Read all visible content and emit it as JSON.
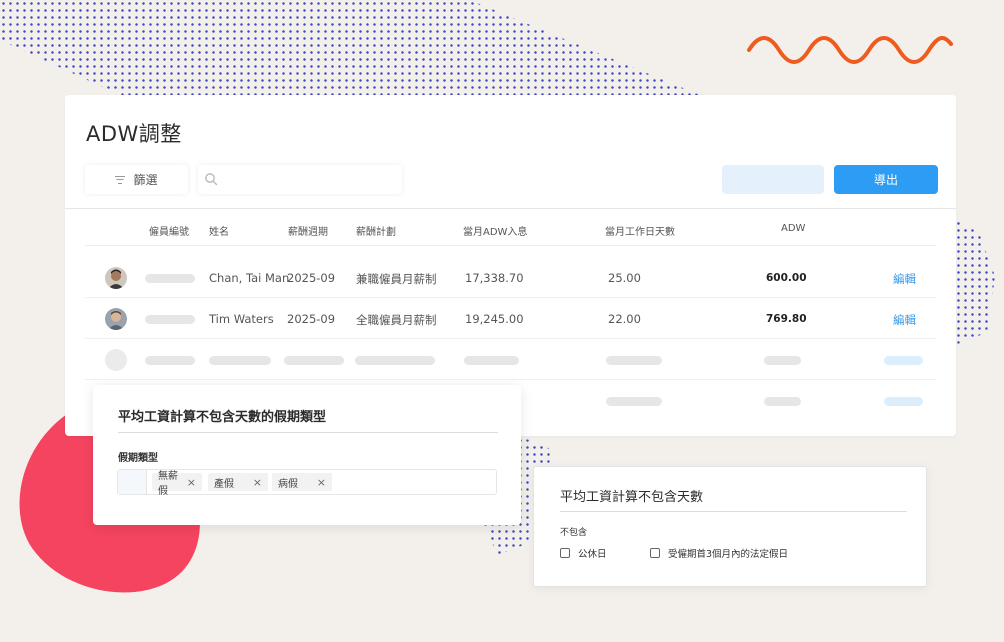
{
  "page": {
    "title": "ADW調整"
  },
  "toolbar": {
    "filter_label": "篩選",
    "search_placeholder": "",
    "export_label": "導出"
  },
  "table": {
    "headers": [
      "僱員編號",
      "姓名",
      "薪酬週期",
      "薪酬計劃",
      "當月ADW入息",
      "當月工作日天數",
      "ADW"
    ],
    "rows": [
      {
        "name": "Chan, Tai Man",
        "period": "2025-09",
        "plan": "兼職僱員月薪制",
        "income": "17,338.70",
        "days": "25.00",
        "adw": "600.00",
        "action": "編輯"
      },
      {
        "name": "Tim Waters",
        "period": "2025-09",
        "plan": "全職僱員月薪制",
        "income": "19,245.00",
        "days": "22.00",
        "adw": "769.80",
        "action": "編輯"
      }
    ]
  },
  "leave_popup": {
    "title": "平均工資計算不包含天數的假期類型",
    "field_label": "假期類型",
    "tags": [
      "無薪假",
      "產假",
      "病假"
    ]
  },
  "exclusion_popup": {
    "title": "平均工資計算不包含天數",
    "section_label": "不包含",
    "options": [
      {
        "label": "公休日",
        "checked": false
      },
      {
        "label": "受僱期首3個月內的法定假日",
        "checked": false
      }
    ]
  },
  "colors": {
    "accent": "#2d9cf4",
    "link": "#3a9ae8",
    "blob": "#f4445f",
    "squiggle": "#ef5a1e",
    "dots": "#3b47c8"
  }
}
